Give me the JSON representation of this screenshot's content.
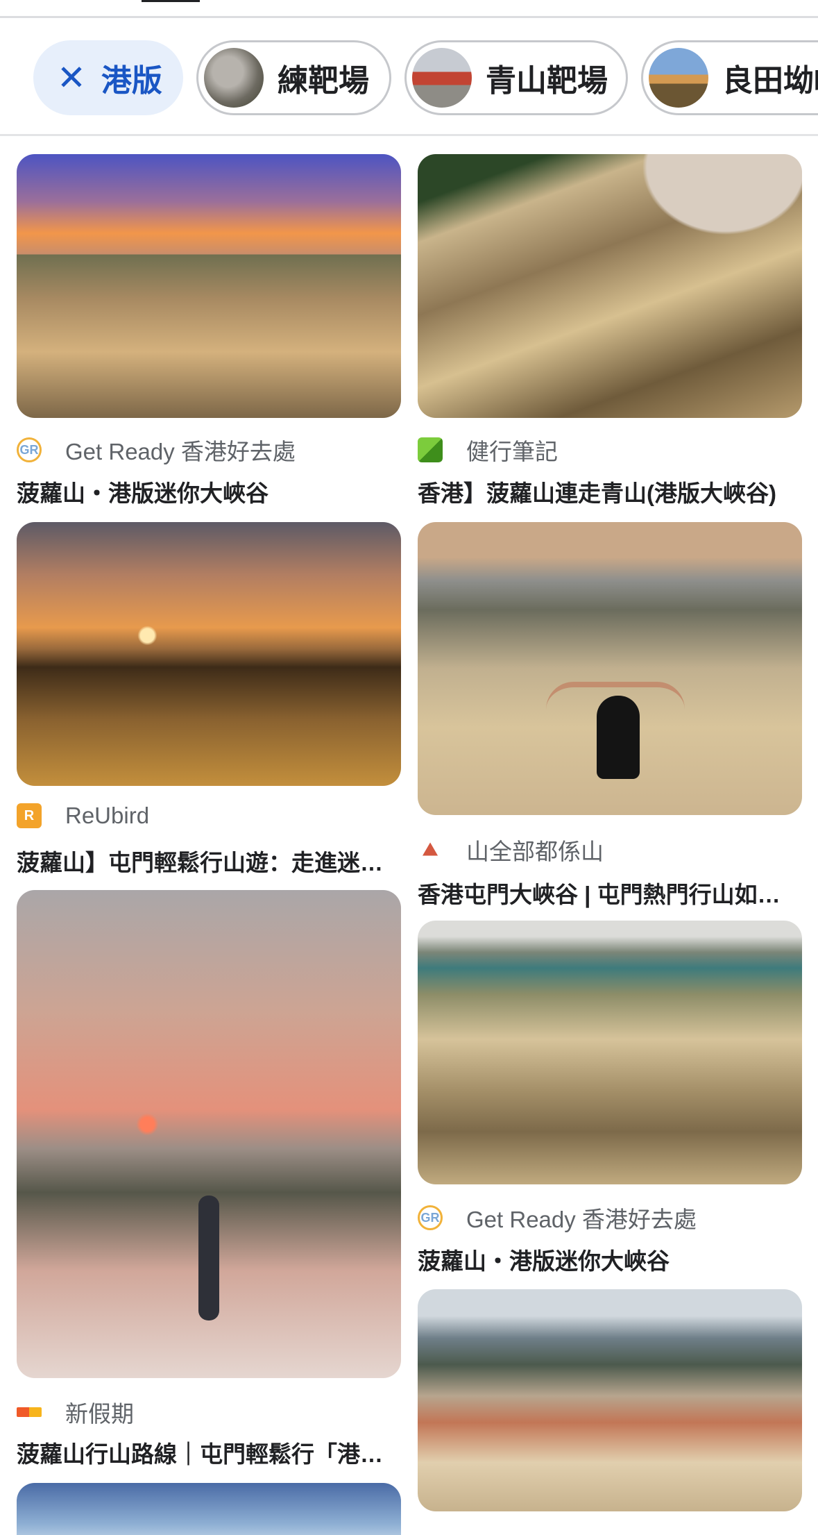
{
  "filter_chips": {
    "selected": {
      "label": "港版",
      "icon": "close-icon"
    },
    "suggestions": [
      {
        "label": "練靶場"
      },
      {
        "label": "青山靶場"
      },
      {
        "label": "良田坳嶼"
      }
    ]
  },
  "results": {
    "left_column": [
      {
        "source": "Get Ready 香港好去處",
        "logo": "get-ready-logo",
        "title": "菠蘿山・港版迷你大峽谷"
      },
      {
        "source": "ReUbird",
        "logo": "reubird-logo",
        "title": "菠蘿山】屯門輕鬆行山遊：走進迷你大峽谷"
      },
      {
        "source": "新假期",
        "logo": "weekend-hk-logo",
        "title": "菠蘿山行山路線｜屯門輕鬆行「港版大峽谷」"
      }
    ],
    "right_column": [
      {
        "source": "健行筆記",
        "logo": "hiking-notes-logo",
        "title": "香港】菠蘿山連走青山(港版大峽谷)"
      },
      {
        "source": "山全部都係山",
        "logo": "mountain-logo",
        "title": "香港屯門大峽谷 | 屯門熱門行山如何去"
      },
      {
        "source": "Get Ready 香港好去處",
        "logo": "get-ready-logo",
        "title": "菠蘿山・港版迷你大峽谷"
      }
    ]
  },
  "colors": {
    "chip_selected_bg": "#e7effb",
    "chip_selected_text": "#1a56c4",
    "title_text": "#202124",
    "source_text": "#5f6368"
  }
}
